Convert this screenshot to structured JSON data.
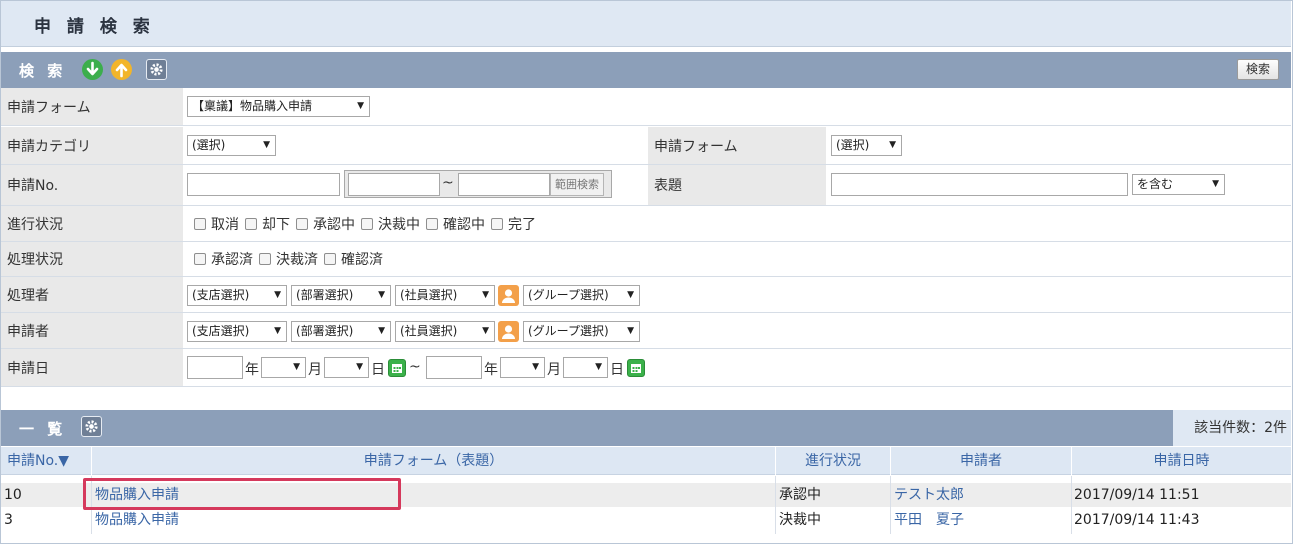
{
  "page": {
    "title": "申 請 検 索"
  },
  "search_section": {
    "title": "検 索",
    "search_button": "検索",
    "icons": [
      "download-arrow-icon",
      "upload-arrow-icon",
      "gear-icon"
    ]
  },
  "form": {
    "form_label": "申請フォーム",
    "form_value": "【稟議】物品購入申請",
    "category_label": "申請カテゴリ",
    "category_value": "(選択)",
    "form2_label": "申請フォーム",
    "form2_value": "(選択)",
    "no_label": "申請No.",
    "no_value": "",
    "range_from": "",
    "range_sep": "~",
    "range_to": "",
    "range_button": "範囲検索",
    "subject_label": "表題",
    "subject_value": "",
    "subject_match": "を含む",
    "progress_label": "進行状況",
    "progress_options": [
      "取消",
      "却下",
      "承認中",
      "決裁中",
      "確認中",
      "完了"
    ],
    "process_status_label": "処理状況",
    "process_status_options": [
      "承認済",
      "決裁済",
      "確認済"
    ],
    "processor_label": "処理者",
    "applicant_label": "申請者",
    "branch_select": "(支店選択)",
    "dept_select": "(部署選択)",
    "staff_select": "(社員選択)",
    "group_select": "(グループ選択)",
    "date_label": "申請日",
    "year_unit": "年",
    "month_unit": "月",
    "day_unit": "日",
    "date_sep": "~"
  },
  "list_section": {
    "title": "一 覧",
    "count_text": "該当件数：2件",
    "columns": [
      "申請No.▼",
      "申請フォーム（表題）",
      "進行状況",
      "申請者",
      "申請日時"
    ],
    "rows": [
      {
        "no": "10",
        "form": "物品購入申請",
        "status": "承認中",
        "applicant": "テスト太郎",
        "datetime": "2017/09/14 11:51"
      },
      {
        "no": "3",
        "form": "物品購入申請",
        "status": "決裁中",
        "applicant": "平田　夏子",
        "datetime": "2017/09/14 11:43"
      }
    ]
  },
  "colors": {
    "section_bar": "#8c9fb9",
    "link": "#3a66a6",
    "highlight": "#d5395c",
    "header_bg": "#dfe8f3"
  }
}
